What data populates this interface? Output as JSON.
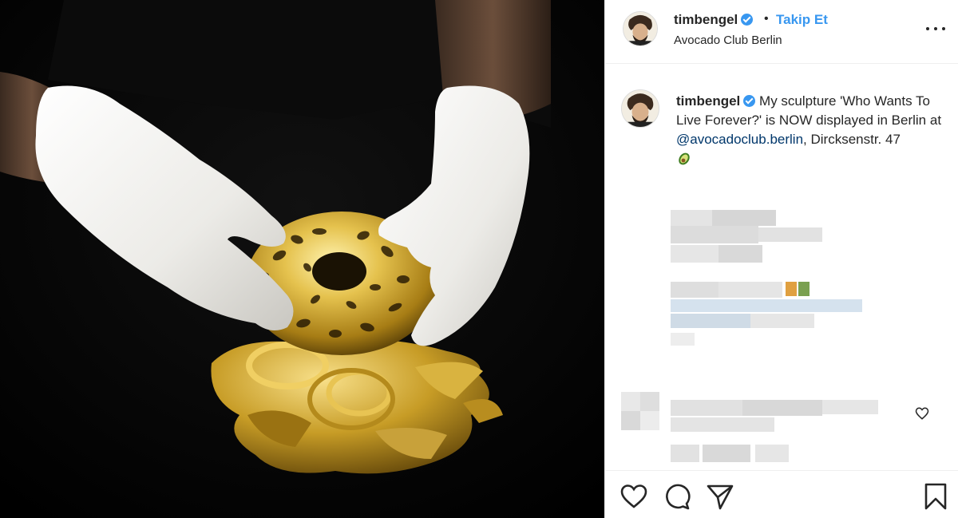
{
  "header": {
    "username": "timbengel",
    "verified_icon": "verified-badge-icon",
    "separator": "•",
    "follow_label": "Takip Et",
    "location": "Avocado Club Berlin",
    "more_icon": "more-options-icon"
  },
  "caption": {
    "username": "timbengel",
    "text_before": "My sculpture 'Who Wants To Live Forever?' is NOW displayed in Berlin at ",
    "mention": "@avocadoclub.berlin",
    "text_after": ", Dircksenstr. 47",
    "emoji": "avocado-emoji"
  },
  "actions": {
    "like_icon": "heart-icon",
    "comment_icon": "comment-icon",
    "share_icon": "paper-plane-icon",
    "save_icon": "bookmark-icon"
  },
  "colors": {
    "accent": "#3897f0",
    "link": "#00376b",
    "text": "#262626",
    "divider": "#efefef",
    "gold": "#c9a42f"
  }
}
